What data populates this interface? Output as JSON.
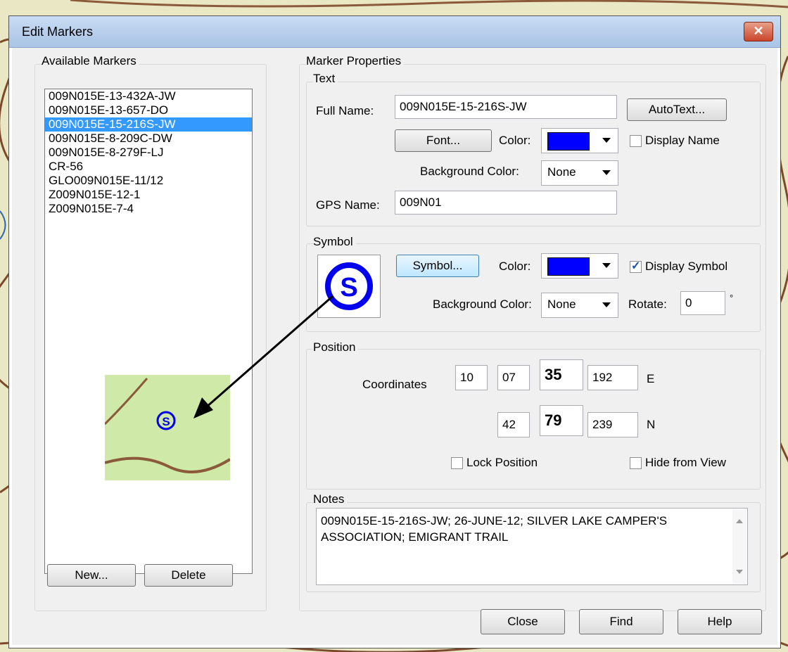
{
  "dialog": {
    "title": "Edit Markers",
    "close_glyph": "✕"
  },
  "available": {
    "label": "Available Markers",
    "items": [
      "009N015E-13-432A-JW",
      "009N015E-13-657-DO",
      "009N015E-15-216S-JW",
      "009N015E-8-209C-DW",
      "009N015E-8-279F-LJ",
      "CR-56",
      "GLO009N015E-11/12",
      "Z009N015E-12-1",
      "Z009N015E-7-4"
    ],
    "selected": "009N015E-15-216S-JW",
    "new_label": "New...",
    "delete_label": "Delete"
  },
  "props": {
    "label": "Marker Properties"
  },
  "text_group": {
    "label": "Text",
    "full_name_label": "Full Name:",
    "full_name": "009N015E-15-216S-JW",
    "autotext_label": "AutoText...",
    "font_label": "Font...",
    "color_label": "Color:",
    "color": "#0000ff",
    "display_name_label": "Display Name",
    "display_name_checked": false,
    "bg_color_label": "Background Color:",
    "bg_color_value": "None",
    "gps_name_label": "GPS Name:",
    "gps_name": "009N01"
  },
  "symbol_group": {
    "label": "Symbol",
    "symbol_glyph": "S",
    "symbol_color": "#0000ee",
    "symbol_button_label": "Symbol...",
    "color_label": "Color:",
    "color": "#0000ff",
    "display_symbol_label": "Display Symbol",
    "display_symbol_checked": true,
    "bg_color_label": "Background Color:",
    "bg_color_value": "None",
    "rotate_label": "Rotate:",
    "rotate_value": "0",
    "degree_symbol": "°"
  },
  "position_group": {
    "label": "Position",
    "coordinates_label": "Coordinates",
    "row1": [
      "10",
      "07",
      "35",
      "192"
    ],
    "row1_hemi": "E",
    "row2": [
      "42",
      "79",
      "239"
    ],
    "row2_hemi": "N",
    "lock_label": "Lock Position",
    "hide_label": "Hide from View"
  },
  "notes_group": {
    "label": "Notes",
    "text": "009N015E-15-216S-JW; 26-JUNE-12; SILVER LAKE CAMPER'S ASSOCIATION; EMIGRANT TRAIL"
  },
  "footer": {
    "close_label": "Close",
    "find_label": "Find",
    "help_label": "Help"
  },
  "preview": {
    "symbol_glyph": "S",
    "bg_color": "#cfe9a8"
  }
}
